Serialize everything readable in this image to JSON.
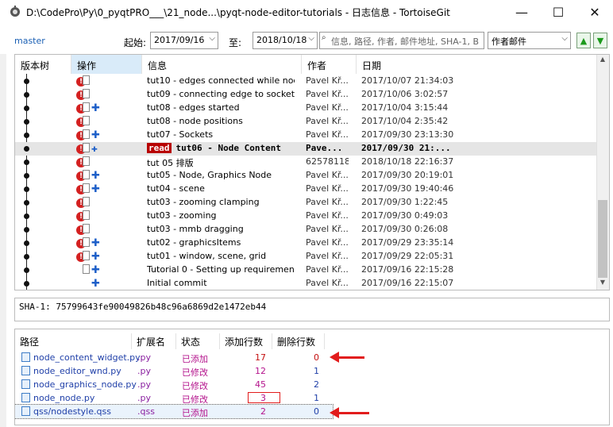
{
  "window": {
    "title": "D:\\CodePro\\Py\\0_pyqtPRO___\\21_node...\\pyqt-node-editor-tutorials - 日志信息 - TortoiseGit",
    "minimize": "—",
    "maximize": "☐",
    "close": "✕"
  },
  "filter": {
    "branch": "master",
    "from_label": "起始:",
    "from_value": "2017/09/16",
    "to_label": "至:",
    "to_value": "2018/10/18",
    "search_placeholder": "信息, 路径, 作者, 邮件地址, SHA-1, B",
    "field_value": "作者邮件"
  },
  "log": {
    "columns": [
      "版本树",
      "操作",
      "信息",
      "作者",
      "日期"
    ],
    "rows": [
      {
        "message": "tut10 - edges connected while node...",
        "author": "Pavel Kř...",
        "date": "2017/10/07 21:34:03",
        "icons": "err-doc"
      },
      {
        "message": "tut09 - connecting edge to socket, ...",
        "author": "Pavel Kř...",
        "date": "2017/10/06 3:02:57",
        "icons": "err-doc"
      },
      {
        "message": "tut08 - edges started",
        "author": "Pavel Kř...",
        "date": "2017/10/04 3:15:44",
        "icons": "err-doc-add"
      },
      {
        "message": "tut08 - node positions",
        "author": "Pavel Kř...",
        "date": "2017/10/04 2:35:42",
        "icons": "err-doc"
      },
      {
        "message": "tut07 - Sockets",
        "author": "Pavel Kř...",
        "date": "2017/09/30 23:13:30",
        "icons": "err-doc-add"
      },
      {
        "message": "tut06 - Node Content",
        "author": "Pave...",
        "date": "2017/09/30 21:...",
        "icons": "err-doc-add",
        "selected": true,
        "badge": "read"
      },
      {
        "message": "tut 05 排版",
        "author": "625781186",
        "date": "2018/10/18 22:16:37",
        "icons": "err-doc"
      },
      {
        "message": "tut05 - Node, Graphics Node",
        "author": "Pavel Kř...",
        "date": "2017/09/30 20:19:01",
        "icons": "err-doc-add"
      },
      {
        "message": "tut04 - scene",
        "author": "Pavel Kř...",
        "date": "2017/09/30 19:40:46",
        "icons": "err-doc-add"
      },
      {
        "message": "tut03 - zooming clamping",
        "author": "Pavel Kř...",
        "date": "2017/09/30 1:22:45",
        "icons": "err-doc"
      },
      {
        "message": "tut03 - zooming",
        "author": "Pavel Kř...",
        "date": "2017/09/30 0:49:03",
        "icons": "err-doc"
      },
      {
        "message": "tut03 - mmb dragging",
        "author": "Pavel Kř...",
        "date": "2017/09/30 0:26:08",
        "icons": "err-doc"
      },
      {
        "message": "tut02 - graphicsItems",
        "author": "Pavel Kř...",
        "date": "2017/09/29 23:35:14",
        "icons": "err-doc-add"
      },
      {
        "message": "tut01 - window, scene, grid",
        "author": "Pavel Kř...",
        "date": "2017/09/29 22:05:31",
        "icons": "err-doc-add"
      },
      {
        "message": "Tutorial 0 - Setting up requirements",
        "author": "Pavel Kř...",
        "date": "2017/09/16 22:15:28",
        "icons": "doc-add"
      },
      {
        "message": "Initial commit",
        "author": "Pavel Kř...",
        "date": "2017/09/16 22:15:07",
        "icons": "add"
      }
    ]
  },
  "sha": "SHA-1: 75799643fe90049826b48c96a6869d2e1472eb44",
  "files": {
    "columns": [
      "路径",
      "扩展名",
      "状态",
      "添加行数",
      "删除行数"
    ],
    "rows": [
      {
        "path": "node_content_widget.py",
        "ext": ".py",
        "status": "已添加",
        "added": "17",
        "deleted": "0"
      },
      {
        "path": "node_editor_wnd.py",
        "ext": ".py",
        "status": "已修改",
        "added": "12",
        "deleted": "1"
      },
      {
        "path": "node_graphics_node.py",
        "ext": ".py",
        "status": "已修改",
        "added": "45",
        "deleted": "2"
      },
      {
        "path": "node_node.py",
        "ext": ".py",
        "status": "已修改",
        "added": "3",
        "deleted": "1"
      },
      {
        "path": "qss/nodestyle.qss",
        "ext": ".qss",
        "status": "已添加",
        "added": "2",
        "deleted": "0",
        "selected": true
      }
    ]
  },
  "colors": {
    "accent": "#1e5fc8",
    "error": "#d42020",
    "annotation": "#e21c1c"
  }
}
